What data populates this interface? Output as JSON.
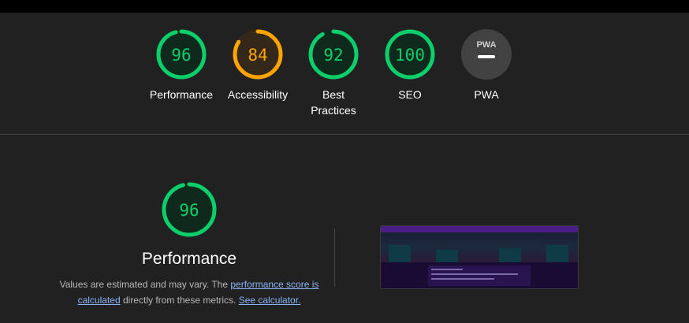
{
  "gauges": [
    {
      "label": "Performance",
      "score": "96",
      "value": 96,
      "color": "#0cce6b"
    },
    {
      "label": "Accessibility",
      "score": "84",
      "value": 84,
      "color": "#ffa400"
    },
    {
      "label": "Best Practices",
      "score": "92",
      "value": 92,
      "color": "#0cce6b"
    },
    {
      "label": "SEO",
      "score": "100",
      "value": 100,
      "color": "#0cce6b"
    },
    {
      "label": "PWA",
      "score": "PWA",
      "value": null,
      "color": "#9e9e9e"
    }
  ],
  "performance": {
    "score": "96",
    "value": 96,
    "title": "Performance",
    "desc_part1": "Values are estimated and may vary. The ",
    "desc_link1": "performance score is calculated",
    "desc_part2": " directly from these metrics. ",
    "desc_link2": "See calculator."
  },
  "screenshot_thumbnail": {
    "icon": "page-screenshot"
  }
}
